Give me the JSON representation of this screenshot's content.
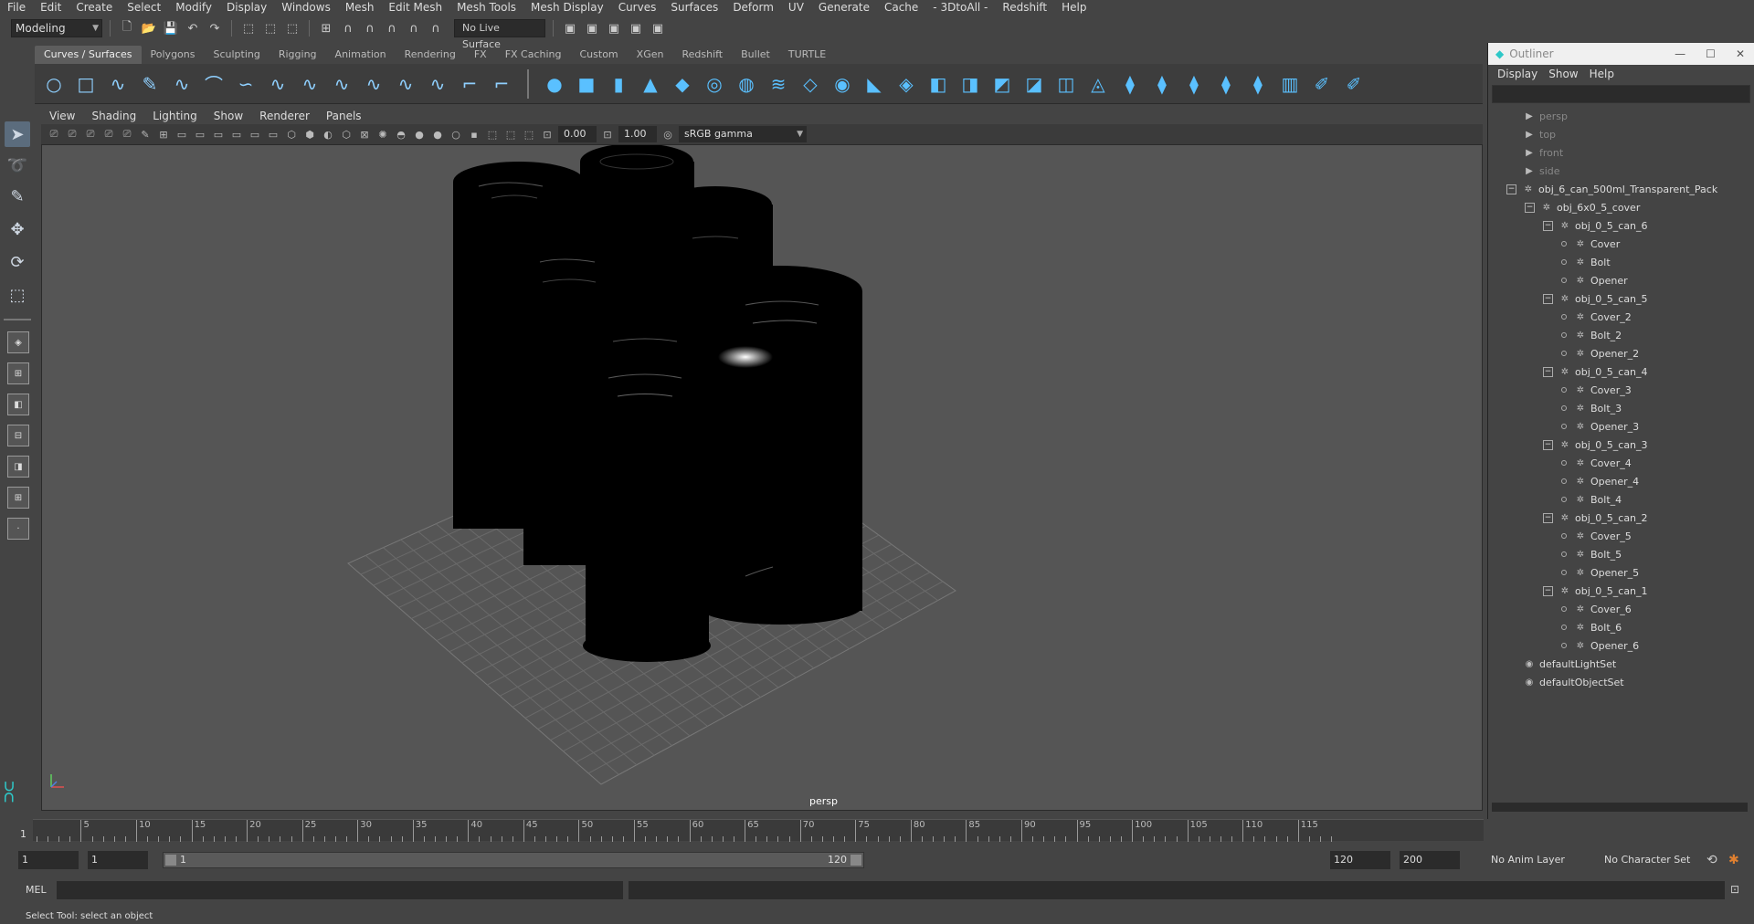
{
  "menubar": [
    "File",
    "Edit",
    "Create",
    "Select",
    "Modify",
    "Display",
    "Windows",
    "Mesh",
    "Edit Mesh",
    "Mesh Tools",
    "Mesh Display",
    "Curves",
    "Surfaces",
    "Deform",
    "UV",
    "Generate",
    "Cache",
    "- 3DtoAll -",
    "Redshift",
    "Help"
  ],
  "status": {
    "mode": "Modeling",
    "live_surface": "No Live Surface"
  },
  "shelf_tabs": [
    "Curves / Surfaces",
    "Polygons",
    "Sculpting",
    "Rigging",
    "Animation",
    "Rendering",
    "FX",
    "FX Caching",
    "Custom",
    "XGen",
    "Redshift",
    "Bullet",
    "TURTLE"
  ],
  "panel_menu": [
    "View",
    "Shading",
    "Lighting",
    "Show",
    "Renderer",
    "Panels"
  ],
  "panel_tools": {
    "exposure": "0.00",
    "gamma": "1.00",
    "color_space": "sRGB gamma"
  },
  "viewport": {
    "camera": "persp"
  },
  "outliner": {
    "title": "Outliner",
    "menu": [
      "Display",
      "Show",
      "Help"
    ],
    "items": [
      {
        "label": "persp"
      },
      {
        "label": "top"
      },
      {
        "label": "front"
      },
      {
        "label": "side"
      },
      {
        "label": "obj_6_can_500ml_Transparent_Pack"
      },
      {
        "label": "obj_6x0_5_cover"
      },
      {
        "label": "obj_0_5_can_6"
      },
      {
        "label": "Cover"
      },
      {
        "label": "Bolt"
      },
      {
        "label": "Opener"
      },
      {
        "label": "obj_0_5_can_5"
      },
      {
        "label": "Cover_2"
      },
      {
        "label": "Bolt_2"
      },
      {
        "label": "Opener_2"
      },
      {
        "label": "obj_0_5_can_4"
      },
      {
        "label": "Cover_3"
      },
      {
        "label": "Bolt_3"
      },
      {
        "label": "Opener_3"
      },
      {
        "label": "obj_0_5_can_3"
      },
      {
        "label": "Cover_4"
      },
      {
        "label": "Opener_4"
      },
      {
        "label": "Bolt_4"
      },
      {
        "label": "obj_0_5_can_2"
      },
      {
        "label": "Cover_5"
      },
      {
        "label": "Bolt_5"
      },
      {
        "label": "Opener_5"
      },
      {
        "label": "obj_0_5_can_1"
      },
      {
        "label": "Cover_6"
      },
      {
        "label": "Bolt_6"
      },
      {
        "label": "Opener_6"
      },
      {
        "label": "defaultLightSet"
      },
      {
        "label": "defaultObjectSet"
      }
    ]
  },
  "timeslider": {
    "labels": [
      "5",
      "10",
      "15",
      "20",
      "25",
      "30",
      "35",
      "40",
      "45",
      "50",
      "55",
      "60",
      "65",
      "70",
      "75",
      "80",
      "85",
      "90",
      "95",
      "100",
      "105",
      "110",
      "115"
    ],
    "current": "1"
  },
  "range": {
    "start": "1",
    "playback_start": "1",
    "bar_start": "1",
    "bar_end": "120",
    "playback_end": "120",
    "end": "200",
    "anim_layer": "No Anim Layer",
    "char_set": "No Character Set"
  },
  "cmdline": {
    "label": "MEL"
  },
  "helpline": {
    "text": "Select Tool: select an object"
  }
}
